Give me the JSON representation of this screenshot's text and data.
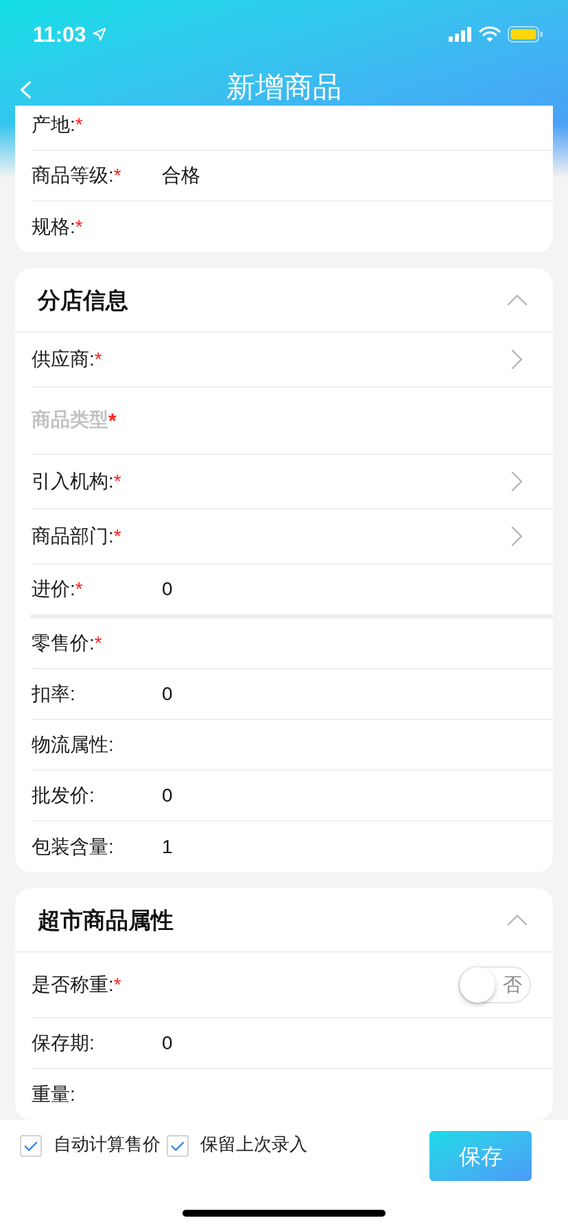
{
  "status_bar": {
    "time": "11:03"
  },
  "nav": {
    "title": "新增商品"
  },
  "sections": [
    {
      "fields": [
        {
          "kind": "text",
          "label": "产地:",
          "mark": "*",
          "disabled": false
        },
        {
          "kind": "text",
          "label": "商品等级:",
          "mark": "*",
          "value": "合格",
          "disabled": false
        },
        {
          "kind": "text",
          "label": "规格:",
          "mark": "*",
          "disabled": false
        }
      ]
    },
    {
      "title": "分店信息",
      "expanded": true,
      "fields": [
        {
          "kind": "picker",
          "label": "供应商:",
          "mark": "*",
          "disabled": false
        },
        {
          "kind": "text",
          "label": "商品类型",
          "mark": "*",
          "disabled": true
        },
        {
          "kind": "picker",
          "label": "引入机构:",
          "mark": "*",
          "disabled": false
        },
        {
          "kind": "picker",
          "label": "商品部门:",
          "mark": "*",
          "disabled": false
        },
        {
          "kind": "text",
          "label": "进价:",
          "mark": "*",
          "value": "0",
          "disabled": false
        },
        {
          "kind": "text",
          "label": "零售价:",
          "mark": "*",
          "disabled": false,
          "thick_divider_above": true
        },
        {
          "kind": "text",
          "label": "扣率:",
          "value": "0",
          "disabled": false
        },
        {
          "kind": "text",
          "label": "物流属性:",
          "disabled": false
        },
        {
          "kind": "text",
          "label": "批发价:",
          "value": "0",
          "disabled": false
        },
        {
          "kind": "text",
          "label": "包装含量:",
          "value": "1",
          "disabled": false
        }
      ]
    },
    {
      "title": "超市商品属性",
      "expanded": true,
      "fields": [
        {
          "kind": "switch",
          "label": "是否称重:",
          "mark": "*",
          "on": false,
          "switch_text": "否",
          "disabled": false
        },
        {
          "kind": "text",
          "label": "保存期:",
          "value": "0",
          "disabled": false
        },
        {
          "kind": "text",
          "label": "重量:",
          "disabled": false
        }
      ]
    }
  ],
  "footer": {
    "options": [
      {
        "label": "自动计算售价",
        "checked": true
      },
      {
        "label": "保留上次录入",
        "checked": true
      }
    ],
    "save_button": "保存"
  }
}
